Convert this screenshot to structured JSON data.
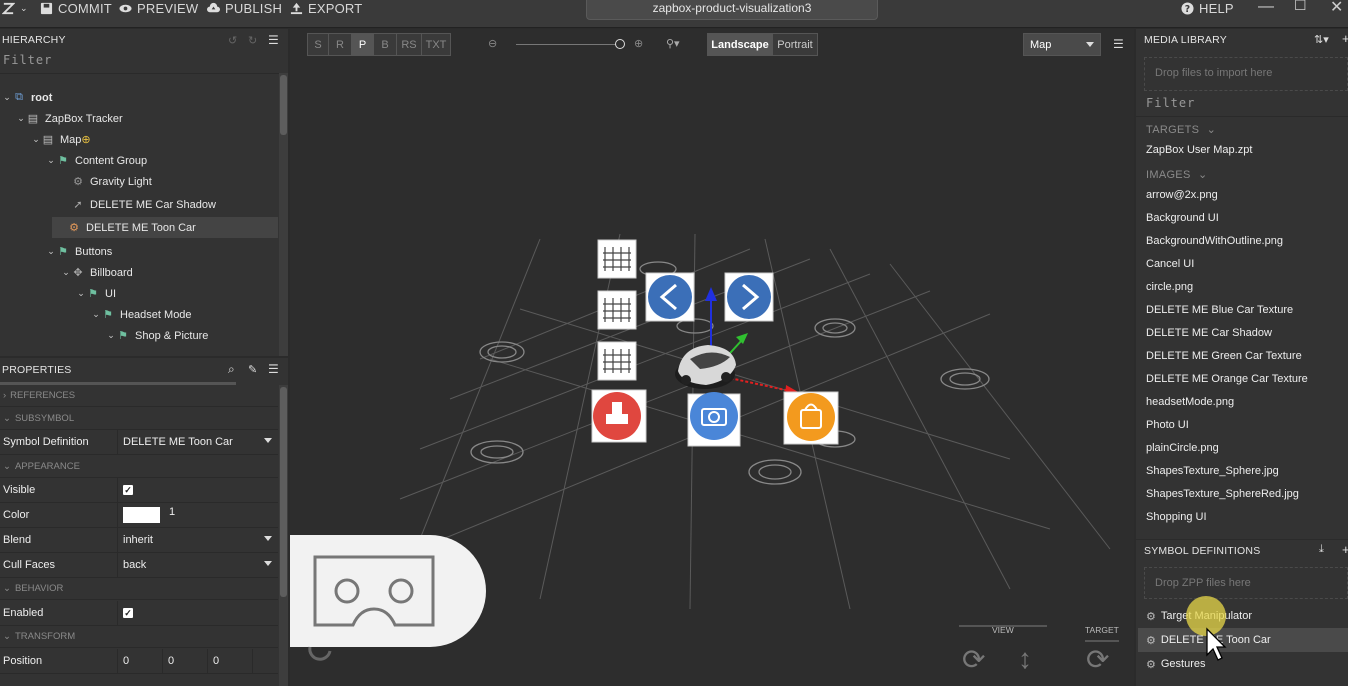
{
  "titlebar": {
    "commit": "COMMIT",
    "preview": "PREVIEW",
    "publish": "PUBLISH",
    "export": "EXPORT",
    "project_name": "zapbox-product-visualization3",
    "help": "HELP"
  },
  "hierarchy": {
    "title": "HIERARCHY",
    "filter": "Filter",
    "items": [
      {
        "label": "root",
        "icon": "hierarchy-icon"
      },
      {
        "label": "ZapBox Tracker",
        "icon": "image-icon"
      },
      {
        "label": "Map",
        "icon": "image-icon"
      },
      {
        "label": "Content Group",
        "icon": "group-icon"
      },
      {
        "label": "Gravity Light",
        "icon": "gear-icon"
      },
      {
        "label": "DELETE ME Car Shadow",
        "icon": "rocket-icon"
      },
      {
        "label": "DELETE ME Toon Car",
        "icon": "gear-icon"
      },
      {
        "label": "Buttons",
        "icon": "group-icon"
      },
      {
        "label": "Billboard",
        "icon": "target-icon"
      },
      {
        "label": "UI",
        "icon": "group-icon"
      },
      {
        "label": "Headset Mode",
        "icon": "group-icon"
      },
      {
        "label": "Shop & Picture",
        "icon": "group-icon"
      }
    ]
  },
  "properties": {
    "title": "PROPERTIES",
    "sections": {
      "references": "REFERENCES",
      "subsymbol": "SUBSYMBOL",
      "appearance": "APPEARANCE",
      "behavior": "BEHAVIOR",
      "transform": "TRANSFORM"
    },
    "symbol_definition_label": "Symbol Definition",
    "symbol_definition_value": "DELETE ME Toon Car",
    "visible_label": "Visible",
    "color_label": "Color",
    "color_value": "#ffffff",
    "color_alpha": "1",
    "blend_label": "Blend",
    "blend_value": "inherit",
    "cull_label": "Cull Faces",
    "cull_value": "back",
    "enabled_label": "Enabled",
    "position_label": "Position",
    "position_x": "0",
    "position_y": "0",
    "position_z": "0"
  },
  "viewport": {
    "modes": [
      "S",
      "R",
      "P",
      "B",
      "RS",
      "TXT"
    ],
    "active_mode": "P",
    "landscape": "Landscape",
    "portrait": "Portrait",
    "view_select": "Map",
    "view_label": "VIEW",
    "target_label": "TARGET"
  },
  "media": {
    "title": "MEDIA LIBRARY",
    "drop": "Drop files to import here",
    "filter": "Filter",
    "targets_label": "TARGETS",
    "targets": [
      "ZapBox User Map.zpt"
    ],
    "images_label": "IMAGES",
    "images": [
      "arrow@2x.png",
      "Background UI",
      "BackgroundWithOutline.png",
      "Cancel UI",
      "circle.png",
      "DELETE ME Blue Car Texture",
      "DELETE ME Car Shadow",
      "DELETE ME Green Car Texture",
      "DELETE ME Orange Car Texture",
      "headsetMode.png",
      "Photo UI",
      "plainCircle.png",
      "ShapesTexture_Sphere.jpg",
      "ShapesTexture_SphereRed.jpg",
      "Shopping UI"
    ]
  },
  "symbols": {
    "title": "SYMBOL DEFINITIONS",
    "drop": "Drop ZPP files here",
    "items": [
      "Target Manipulator",
      "DELETE ME Toon Car",
      "Gestures"
    ]
  },
  "colors": {
    "accent_red": "#e0473f",
    "accent_blue": "#4a86d8",
    "accent_orange": "#f39a1e",
    "cursor_highlight": "#e8d84a"
  }
}
